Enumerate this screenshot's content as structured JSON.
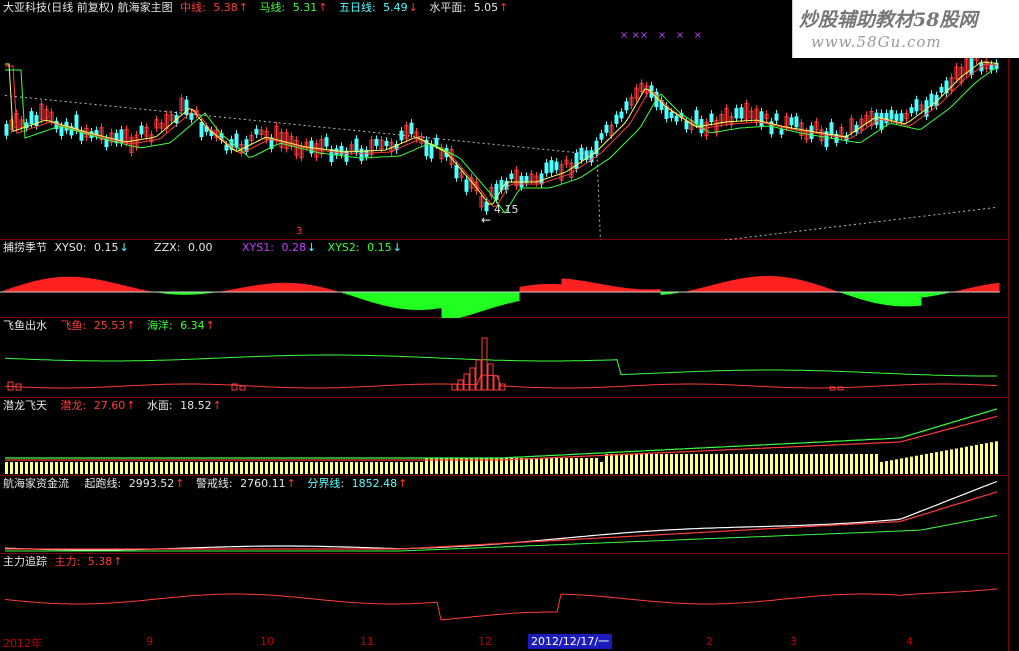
{
  "main": {
    "title": "大亚科技(日线 前复权) 航海家主图",
    "items": [
      {
        "label": "中线:",
        "value": "5.38",
        "color": "#ff3b3b"
      },
      {
        "label": "马线:",
        "value": "5.31",
        "color": "#3cff3c"
      },
      {
        "label": "五日线:",
        "value": "5.49",
        "color": "#54ffff"
      },
      {
        "label": "水平面:",
        "value": "5.05",
        "color": "#e6e6e6"
      }
    ],
    "low_label": "4.15",
    "low_arrow": "←",
    "mark": "3",
    "cross": "× ××   ×   ×   ×"
  },
  "p2": {
    "title": "捕捞季节",
    "xys0": "XYS0:",
    "xys0_v": "0.15",
    "zzx": "ZZX:",
    "zzx_v": "0.00",
    "xys1": "XYS1:",
    "xys1_v": "0.28",
    "xys2": "XYS2:",
    "xys2_v": "0.15"
  },
  "p3": {
    "title": "飞鱼出水",
    "a": "飞鱼:",
    "a_v": "25.53",
    "b": "海洋:",
    "b_v": "6.34"
  },
  "p4": {
    "title": "潜龙飞天",
    "a": "潜龙:",
    "a_v": "27.60",
    "b": "水面:",
    "b_v": "18.52"
  },
  "p5": {
    "title": "航海家资金流",
    "a": "起跑线:",
    "a_v": "2993.52",
    "b": "警戒线:",
    "b_v": "2760.11",
    "c": "分界线:",
    "c_v": "1852.48"
  },
  "p6": {
    "title": "主力追踪",
    "a": "主力:",
    "a_v": "5.38"
  },
  "up": "↑",
  "down": "↓",
  "watermark": {
    "line1": "炒股辅助教材58股网",
    "line2": "www.58Gu.com"
  },
  "axis": {
    "ticks": [
      "2012年",
      "9",
      "10",
      "11",
      "12",
      "2",
      "3",
      "4"
    ],
    "selected": "2012/12/17/一"
  },
  "chart_data": {
    "type": "candlestick",
    "title": "大亚科技(日线 前复权)",
    "lowest": 4.15,
    "indicators": [
      "捕捞季节",
      "飞鱼出水",
      "潜龙飞天",
      "航海家资金流",
      "主力追踪"
    ]
  }
}
